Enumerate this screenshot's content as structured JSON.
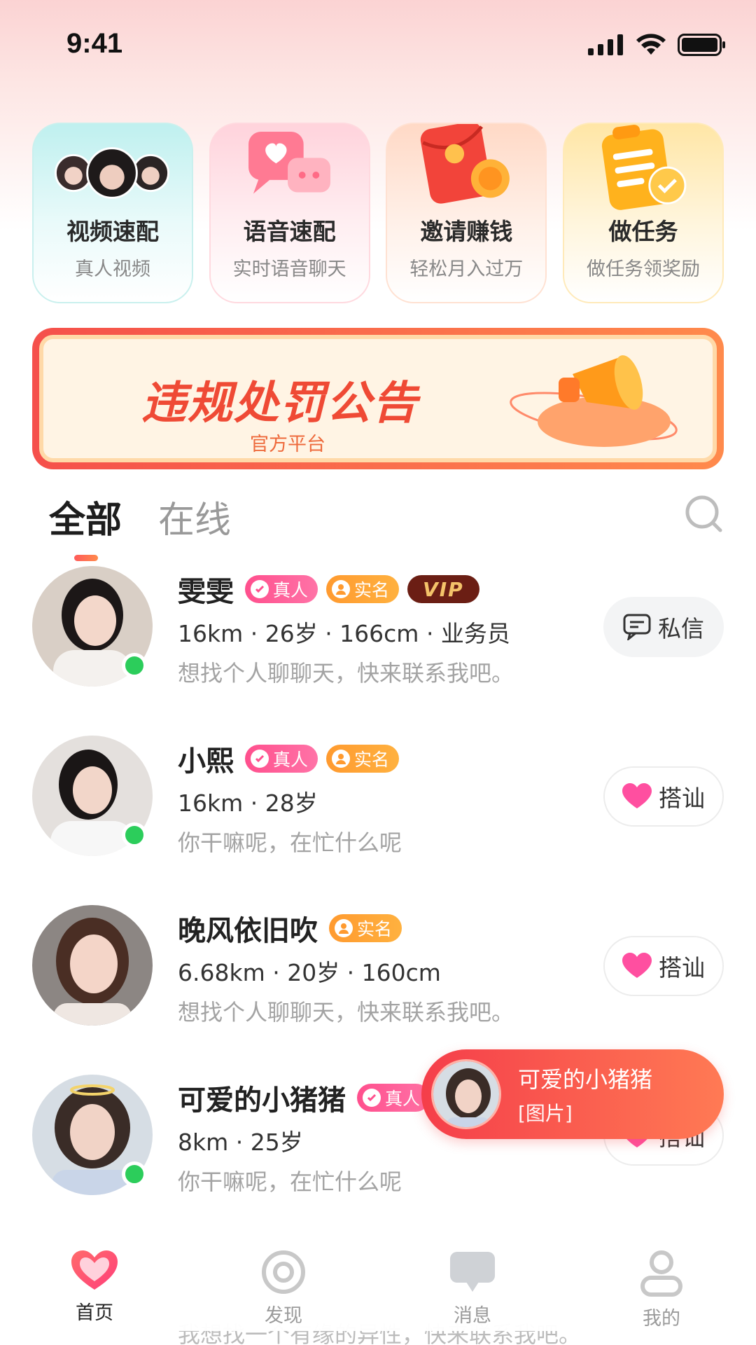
{
  "status_bar": {
    "time": "9:41"
  },
  "quick_entries": [
    {
      "title": "视频速配",
      "subtitle": "真人视频"
    },
    {
      "title": "语音速配",
      "subtitle": "实时语音聊天"
    },
    {
      "title": "邀请赚钱",
      "subtitle": "轻松月入过万"
    },
    {
      "title": "做任务",
      "subtitle": "做任务领奖励"
    }
  ],
  "banner": {
    "title": "违规处罚公告",
    "subtitle": "官方平台"
  },
  "tabs": [
    {
      "label": "全部",
      "active": true
    },
    {
      "label": "在线",
      "active": false
    }
  ],
  "badges": {
    "real": "真人",
    "verified": "实名",
    "vip": "VIP"
  },
  "users": [
    {
      "name": "雯雯",
      "info": "16km · 26岁 · 166cm · 业务员",
      "desc": "想找个人聊聊天，快来联系我吧。",
      "online": true,
      "action": "私信"
    },
    {
      "name": "小熙",
      "info": "16km · 28岁",
      "desc": "你干嘛呢，在忙什么呢",
      "online": true,
      "action": "搭讪"
    },
    {
      "name": "晚风依旧吹",
      "info": "6.68km · 20岁 · 160cm",
      "desc": "想找个人聊聊天，快来联系我吧。",
      "online": false,
      "action": "搭讪"
    },
    {
      "name": "可爱的小猪猪",
      "info": "8km · 25岁",
      "desc": "你干嘛呢，在忙什么呢",
      "online": true,
      "action": "搭讪"
    }
  ],
  "peek_text": "我想找一个有缘的异性，快来联系我吧。",
  "toast": {
    "name": "可爱的小猪猪",
    "message": "[图片]"
  },
  "bottom_nav": [
    {
      "label": "首页",
      "icon": "heart-icon",
      "active": true
    },
    {
      "label": "发现",
      "icon": "discover-icon",
      "active": false
    },
    {
      "label": "消息",
      "icon": "message-icon",
      "active": false
    },
    {
      "label": "我的",
      "icon": "profile-icon",
      "active": false
    }
  ],
  "colors": {
    "accent": "#ff5a5a",
    "online": "#2ccd5b",
    "real_badge": "#ff4f8d",
    "verified_badge": "#ff9a2f"
  }
}
